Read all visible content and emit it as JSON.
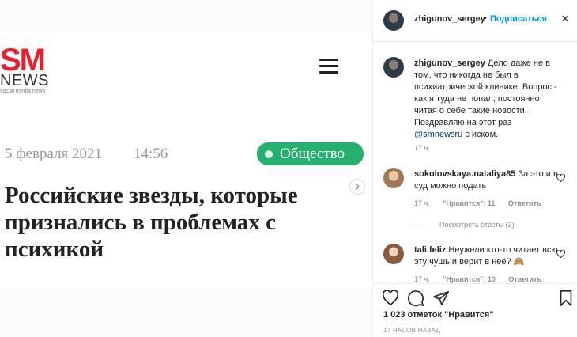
{
  "article": {
    "logo_sm": "SM",
    "logo_news": "NEWS",
    "logo_sub": "social media news",
    "date": "5 февраля 2021",
    "time": "14:56",
    "category": "Общество",
    "headline": "Российские звезды, которые признались в проблемах с психикой"
  },
  "header": {
    "username": "zhigunov_sergey",
    "separator": "•",
    "follow_label": "Подписаться",
    "close_icon": "×"
  },
  "caption": {
    "username": "zhigunov_sergey",
    "text_before_mention": "Дело даже не в том, что никогда не был в психиатрической клинике. Вопрос - как я туда не попал, постоянно читая о себе такие новости. Поздравляю на этот раз",
    "mention": "@smnewsru",
    "text_after_mention": "с иском.",
    "time": "17 ч."
  },
  "comments": [
    {
      "username": "sokolovskaya.nataliya85",
      "text": "За это и в суд можно подать",
      "time": "17 ч.",
      "likes": "\"Нравится\": 11",
      "reply_label": "Ответить",
      "view_replies": "Посмотреть ответы (2)"
    },
    {
      "username": "tali.feliz",
      "text": "Неужели кто-то читает всю эту чушь и верит в неё? 🙈",
      "time": "17 ч.",
      "likes": "\"Нравится\": 10",
      "reply_label": "Ответить"
    }
  ],
  "footer": {
    "likes_text": "1 023 отметок \"Нравится\"",
    "time_ago": "17 ЧАСОВ НАЗАД"
  },
  "icons": {
    "like": "heart-icon",
    "comment": "comment-icon",
    "share": "share-icon",
    "save": "bookmark-icon"
  },
  "colors": {
    "accent": "#0095f6",
    "brand_red": "#e8202e",
    "category_green": "#25b06f"
  }
}
